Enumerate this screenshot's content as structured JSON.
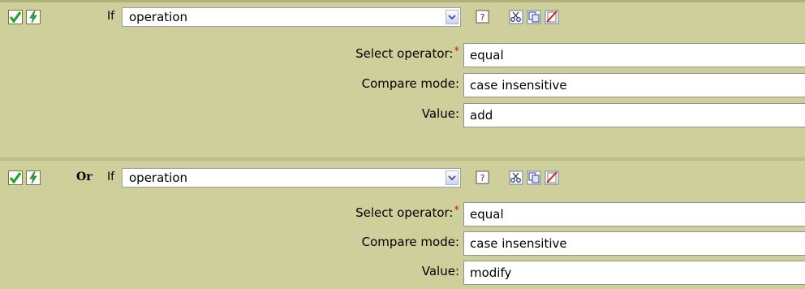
{
  "conditions": [
    {
      "prefix": "",
      "if_label": "If",
      "selector": "operation",
      "fields": [
        {
          "label": "Select operator:",
          "required": true,
          "value": "equal"
        },
        {
          "label": "Compare mode:",
          "required": false,
          "value": "case insensitive"
        },
        {
          "label": "Value:",
          "required": false,
          "value": "add"
        }
      ]
    },
    {
      "prefix": "Or",
      "if_label": "If",
      "selector": "operation",
      "fields": [
        {
          "label": "Select operator:",
          "required": true,
          "value": "equal"
        },
        {
          "label": "Compare mode:",
          "required": false,
          "value": "case insensitive"
        },
        {
          "label": "Value:",
          "required": false,
          "value": "modify"
        }
      ]
    }
  ],
  "required_marker": "*",
  "help_glyph": "?",
  "icons": [
    "enable-check-icon",
    "disable-toggle-icon",
    "help-icon",
    "cut-icon",
    "copy-icon",
    "delete-icon"
  ],
  "colors": {
    "panel": "#cfcf9b",
    "separator": "#bcbc86",
    "required": "#d21b1b"
  }
}
